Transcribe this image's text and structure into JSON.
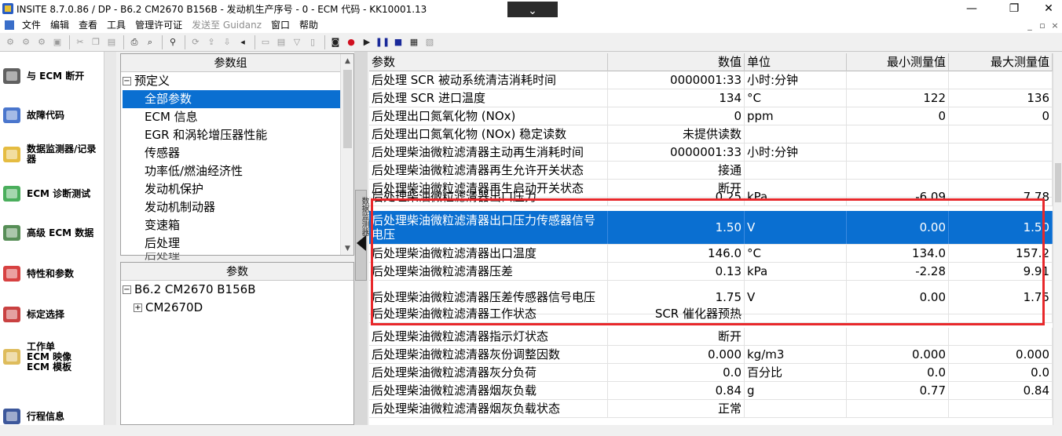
{
  "titlebar": {
    "title": "INSITE 8.7.0.86  / DP - B6.2 CM2670 B156B - 发动机生产序号 - 0 - ECM 代码 - KK10001.13",
    "dropdown_glyph": "⌄",
    "minimize": "—",
    "restore": "❐",
    "close": "✕"
  },
  "menubar": {
    "items": [
      {
        "label": "文件",
        "disabled": false
      },
      {
        "label": "编辑",
        "disabled": false
      },
      {
        "label": "查看",
        "disabled": false
      },
      {
        "label": "工具",
        "disabled": false
      },
      {
        "label": "管理许可证",
        "disabled": false
      },
      {
        "label": "发送至 Guidanz",
        "disabled": true
      },
      {
        "label": "窗口",
        "disabled": false
      },
      {
        "label": "帮助",
        "disabled": false
      }
    ],
    "mdi_min": "_",
    "mdi_restore": "▫",
    "mdi_close": "×"
  },
  "toolbar": {
    "icons": [
      "connect-icon",
      "disconnect-icon",
      "ecm-icon",
      "save-icon",
      "cut-icon",
      "copy-icon",
      "paste-icon",
      "print-icon",
      "print-preview-icon",
      "find-icon",
      "refresh-icon",
      "export-icon",
      "import-icon",
      "parameter-icon",
      "document-icon",
      "report-icon",
      "filter-icon",
      "sheet-icon",
      "snapshot-icon",
      "record-icon",
      "play-icon",
      "pause-icon",
      "stop-icon",
      "monitor-icon",
      "trend-icon"
    ]
  },
  "sidebar": {
    "items": [
      {
        "label": "与 ECM 断开",
        "icon": "disconnect-plug-icon"
      },
      {
        "label": "故障代码",
        "icon": "gears-icon"
      },
      {
        "label": "数据监测器/记录器",
        "icon": "monitor-recorder-icon"
      },
      {
        "label": "ECM 诊断测试",
        "icon": "flask-icon"
      },
      {
        "label": "高级 ECM 数据",
        "icon": "advanced-data-icon"
      },
      {
        "label": "特性和参数",
        "icon": "toolbox-icon"
      },
      {
        "label": "标定选择",
        "icon": "calibration-disc-icon"
      },
      {
        "label": "工作单\nECM 映像\nECM 模板",
        "icon": "work-order-icon"
      },
      {
        "label": "行程信息",
        "icon": "trip-info-icon"
      }
    ]
  },
  "param_groups": {
    "header": "参数组",
    "root": "预定义",
    "items": [
      "全部参数",
      "ECM 信息",
      "EGR 和涡轮增压器性能",
      "传感器",
      "功率低/燃油经济性",
      "发动机保护",
      "发动机制动器",
      "变速箱",
      "后处理",
      "后处理"
    ],
    "selected_index": 0
  },
  "params_tree": {
    "header": "参数",
    "root": "B6.2 CM2670 B156B",
    "child": "CM2670D"
  },
  "splitter": {
    "tab_label": "数据监测器"
  },
  "grid": {
    "columns": [
      "参数",
      "数值",
      "单位",
      "最小测量值",
      "最大测量值"
    ],
    "rows": [
      {
        "name": "后处理 SCR 被动系统清洁消耗时间",
        "value": "0000001:33",
        "unit": "小时:分钟",
        "min": "",
        "max": ""
      },
      {
        "name": "后处理 SCR 进口温度",
        "value": "134",
        "unit": "°C",
        "min": "122",
        "max": "136"
      },
      {
        "name": "后处理出口氮氧化物 (NOx)",
        "value": "0",
        "unit": "ppm",
        "min": "0",
        "max": "0"
      },
      {
        "name": "后处理出口氮氧化物 (NOx) 稳定读数",
        "value": "未提供读数",
        "unit": "",
        "min": "",
        "max": ""
      },
      {
        "name": "后处理柴油微粒滤清器主动再生消耗时间",
        "value": "0000001:33",
        "unit": "小时:分钟",
        "min": "",
        "max": ""
      },
      {
        "name": "后处理柴油微粒滤清器再生允许开关状态",
        "value": "接通",
        "unit": "",
        "min": "",
        "max": ""
      },
      {
        "name": "后处理柴油微粒滤清器再生启动开关状态",
        "value": "断开",
        "unit": "",
        "min": "",
        "max": ""
      },
      {
        "name": "后处理柴油微粒滤清器出口压力",
        "value": "0.25",
        "unit": "kPa",
        "min": "-6.09",
        "max": "7.78"
      },
      {
        "name": "后处理柴油微粒滤清器出口压力传感器信号电压",
        "value": "1.50",
        "unit": "V",
        "min": "0.00",
        "max": "1.50"
      },
      {
        "name": "后处理柴油微粒滤清器出口温度",
        "value": "146.0",
        "unit": "°C",
        "min": "134.0",
        "max": "157.2"
      },
      {
        "name": "后处理柴油微粒滤清器压差",
        "value": "0.13",
        "unit": "kPa",
        "min": "-2.28",
        "max": "9.91"
      },
      {
        "name": "后处理柴油微粒滤清器压差传感器信号电压",
        "value": "1.75",
        "unit": "V",
        "min": "0.00",
        "max": "1.75"
      },
      {
        "name": "后处理柴油微粒滤清器工作状态",
        "value": "SCR 催化器预热",
        "unit": "",
        "min": "",
        "max": ""
      },
      {
        "name": "后处理柴油微粒滤清器指示灯状态",
        "value": "断开",
        "unit": "",
        "min": "",
        "max": ""
      },
      {
        "name": "后处理柴油微粒滤清器灰份调整因数",
        "value": "0.000",
        "unit": "kg/m3",
        "min": "0.000",
        "max": "0.000"
      },
      {
        "name": "后处理柴油微粒滤清器灰分负荷",
        "value": "0.0",
        "unit": "百分比",
        "min": "0.0",
        "max": "0.0"
      },
      {
        "name": "后处理柴油微粒滤清器烟灰负载",
        "value": "0.84",
        "unit": "g",
        "min": "0.77",
        "max": "0.84"
      },
      {
        "name": "后处理柴油微粒滤清器烟灰负载状态",
        "value": "正常",
        "unit": "",
        "min": "",
        "max": ""
      }
    ],
    "selected_index": 8
  },
  "colors": {
    "selection": "#0a6fd1",
    "highlight_box": "#e8282b"
  }
}
